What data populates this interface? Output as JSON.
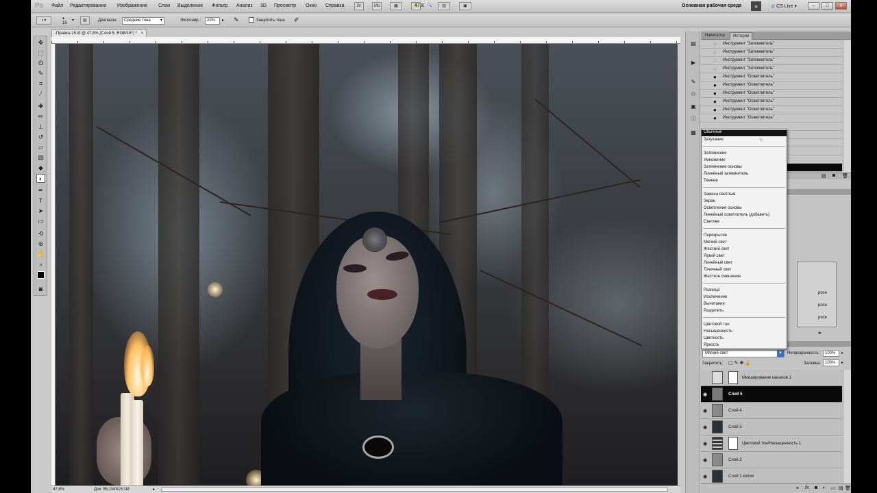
{
  "app": {
    "logo": "Ps"
  },
  "menu": [
    "Файл",
    "Редактирование",
    "Изображение",
    "Слои",
    "Выделение",
    "Фильтр",
    "Анализ",
    "3D",
    "Просмотр",
    "Окно",
    "Справка"
  ],
  "zoom_field": "47,8",
  "workspace": {
    "label": "Основная рабочая среда",
    "more": "»"
  },
  "cslive": "CS Live",
  "window_buttons": [
    "–",
    "□",
    "✕"
  ],
  "options": {
    "brush_size": "15",
    "range_label": "Диапазон:",
    "range_value": "Средние тона",
    "exposure_label": "Экспониp.:",
    "exposure_value": "22%",
    "protect_tones": "Защитить тона"
  },
  "document": {
    "tab_title": "-Правка-15.tif @ 47,8% (Слой 5, RGB/16*) *",
    "close": "×"
  },
  "status": {
    "zoom": "47,8%",
    "doc_size": "Док: 95,1M/415,1M"
  },
  "history": {
    "tabs": [
      "Навигатор",
      "История"
    ],
    "rows": [
      "Инструмент \"Затемнитель\"",
      "Инструмент \"Затемнитель\"",
      "Инструмент \"Затемнитель\"",
      "Инструмент \"Затемнитель\"",
      "Инструмент \"Осветлитель\"",
      "Инструмент \"Осветлитель\"",
      "Инструмент \"Осветлитель\"",
      "Инструмент \"Осветлитель\"",
      "Инструмент \"Осветлитель\"",
      "Инструмент \"Осветлитель\""
    ]
  },
  "blend_modes": {
    "highlighted": "Обычные",
    "groups": [
      [
        "Затухание"
      ],
      [
        "Затемнение",
        "Умножение",
        "Затемнение основы",
        "Линейный затемнитель",
        "Темнее"
      ],
      [
        "Замена светлым",
        "Экран",
        "Осветление основы",
        "Линейный осветлитель (добавить)",
        "Светлее"
      ],
      [
        "Перекрытие",
        "Мягкий свет",
        "Жесткий свет",
        "Яркий свет",
        "Линейный свет",
        "Точечный свет",
        "Жесткое смешение"
      ],
      [
        "Разница",
        "Исключение",
        "Вычитание",
        "Разделить"
      ],
      [
        "Цветовой тон",
        "Насыщенность",
        "Цветность",
        "Яркость"
      ]
    ]
  },
  "panel_fragments": [
    "росе",
    "росе",
    "росе"
  ],
  "layers": {
    "blend_value": "Мягкий свет",
    "opacity_label": "Непрозрачность:",
    "opacity_value": "100%",
    "lock_label": "Закрепить:",
    "fill_label": "Заливка:",
    "fill_value": "100%",
    "rows": [
      {
        "name": "Микширование каналов 1",
        "selected": false,
        "mask": true
      },
      {
        "name": "Слой 5",
        "selected": true,
        "mask": false
      },
      {
        "name": "Слой 4",
        "selected": false,
        "mask": false
      },
      {
        "name": "Слой 3",
        "selected": false,
        "mask": false
      },
      {
        "name": "Цветовой тон/Насыщенность 1",
        "selected": false,
        "mask": true
      },
      {
        "name": "Слой 2",
        "selected": false,
        "mask": false
      },
      {
        "name": "Слой 1 копия",
        "selected": false,
        "mask": false
      }
    ],
    "footer_icons": [
      "link-icon",
      "fx-icon",
      "mask-icon",
      "adjustment-icon",
      "group-icon",
      "new-layer-icon",
      "trash-icon"
    ]
  }
}
